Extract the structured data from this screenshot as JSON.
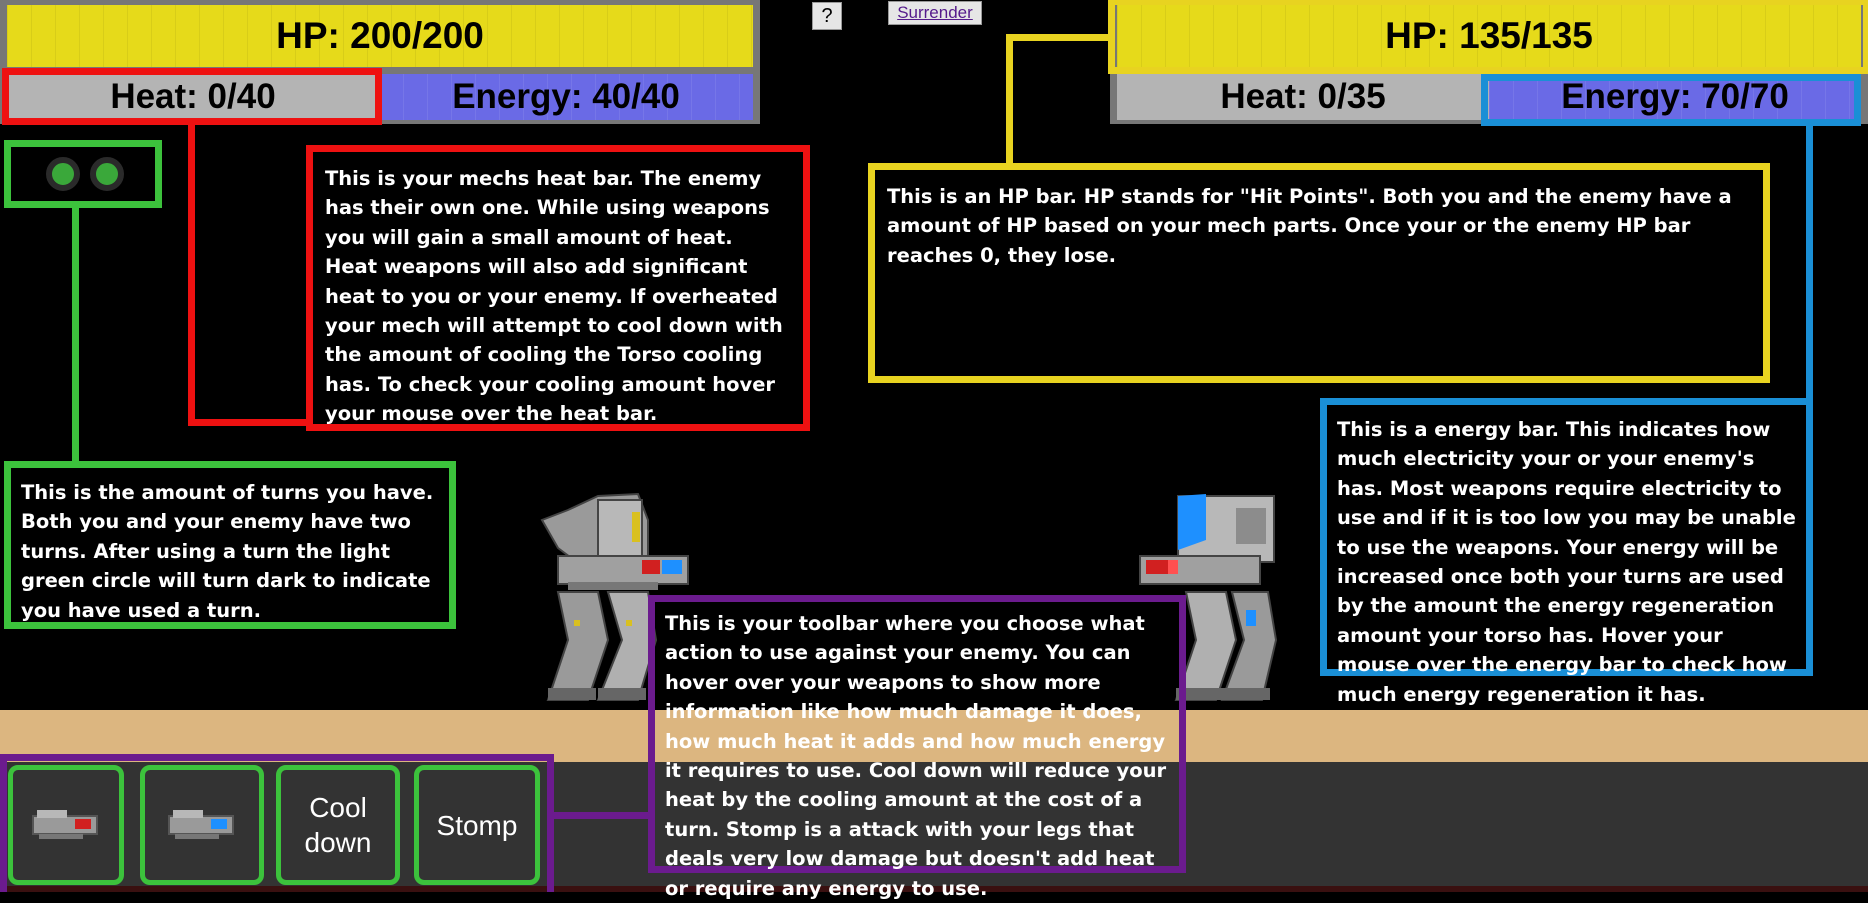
{
  "header": {
    "help_label": "?",
    "surrender_label": "Surrender"
  },
  "player": {
    "hp": "HP: 200/200",
    "heat": "Heat: 0/40",
    "energy": "Energy: 40/40",
    "turns_remaining": 2
  },
  "enemy": {
    "hp": "HP: 135/135",
    "heat": "Heat: 0/35",
    "energy": "Energy: 70/70"
  },
  "tutorial": {
    "heat": "This is your mechs heat bar. The enemy has their own one. While using weapons you will gain a small amount of heat. Heat weapons will also add significant heat to you or your enemy. If overheated your mech will attempt to cool down with the amount of cooling the Torso cooling has. To check your cooling amount hover your mouse over the heat bar.",
    "hp": "This is an HP bar. HP stands for \"Hit Points\". Both you and the enemy have a amount of HP based on your mech parts. Once your or the enemy HP bar reaches 0, they lose.",
    "turns": "This is the amount of turns you have. Both you and your enemy have two turns. After using a turn the light green circle will turn dark to indicate you have used a turn.",
    "energy": "This is a energy bar. This indicates how much electricity your or your enemy's has. Most weapons require electricity to use and if it is too low you may be unable to use the weapons. Your energy will be increased once both your turns are used by the amount the energy regeneration amount your torso has. Hover your mouse over the energy bar to check how much energy regeneration it has.",
    "toolbar": "This is your toolbar where you choose what action to use against your enemy. You can hover over your weapons to show more information like how much damage it does, how much heat it adds and how much energy it requires to use. Cool down will reduce your heat by the cooling amount at the cost of a turn. Stomp is a attack with your legs that deals very low damage but doesn't add heat or require any energy to use."
  },
  "toolbar": {
    "weapon1_icon": "red-laser-gun-icon",
    "weapon2_icon": "blue-laser-gun-icon",
    "cooldown_label": "Cool down",
    "stomp_label": "Stomp"
  },
  "colors": {
    "hp_bar": "#e6da1a",
    "heat_bar": "#b4b4b4",
    "energy_bar": "#6a6ae6",
    "ground": "#dcb680",
    "toolbar_bg": "#333333",
    "red_highlight": "#ee1111",
    "yellow_highlight": "#e8d320",
    "green_highlight": "#3cc23c",
    "blue_highlight": "#1a8fd6",
    "purple_highlight": "#6b1b8e"
  }
}
